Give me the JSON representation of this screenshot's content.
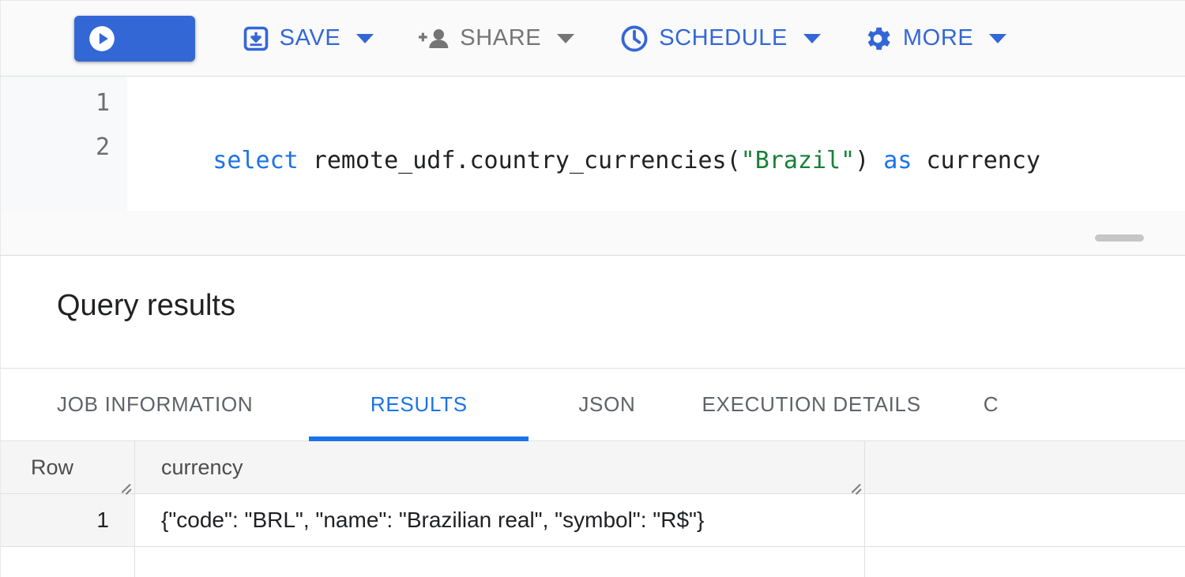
{
  "toolbar": {
    "buttons": [
      {
        "id": "run",
        "label": "RUN",
        "icon": "play-circle-icon",
        "variant": "primary",
        "caret": false
      },
      {
        "id": "save",
        "label": "SAVE",
        "icon": "save-icon",
        "variant": "link",
        "caret": true
      },
      {
        "id": "share",
        "label": "SHARE",
        "icon": "person-add-icon",
        "variant": "disabled",
        "caret": true
      },
      {
        "id": "schedule",
        "label": "SCHEDULE",
        "icon": "clock-icon",
        "variant": "link",
        "caret": true
      },
      {
        "id": "more",
        "label": "MORE",
        "icon": "gear-icon",
        "variant": "link",
        "caret": true
      }
    ]
  },
  "editor": {
    "line_numbers": [
      "1",
      "2"
    ],
    "code": {
      "keyword_select": "select",
      "function_ref": " remote_udf.country_currencies(",
      "string_arg": "\"Brazil\"",
      "close_paren": ") ",
      "keyword_as": "as",
      "alias": " currency"
    }
  },
  "results": {
    "title": "Query results",
    "tabs": [
      {
        "id": "job-information",
        "label": "JOB INFORMATION",
        "active": false
      },
      {
        "id": "results",
        "label": "RESULTS",
        "active": true
      },
      {
        "id": "json",
        "label": "JSON",
        "active": false
      },
      {
        "id": "execution-details",
        "label": "EXECUTION DETAILS",
        "active": false
      },
      {
        "id": "chart-preview",
        "label": "C",
        "active": false
      }
    ],
    "table": {
      "columns": [
        "Row",
        "currency",
        ""
      ],
      "rows": [
        {
          "row": "1",
          "currency": "{\"code\": \"BRL\", \"name\": \"Brazilian real\", \"symbol\": \"R$\"}",
          "filler": ""
        }
      ]
    }
  },
  "colors": {
    "primary_blue": "#3367d6",
    "accent_blue": "#1a73e8",
    "string_green": "#188038",
    "disabled_grey": "#757575",
    "header_grey": "#f5f5f5",
    "panel_grey": "#fafafa"
  }
}
